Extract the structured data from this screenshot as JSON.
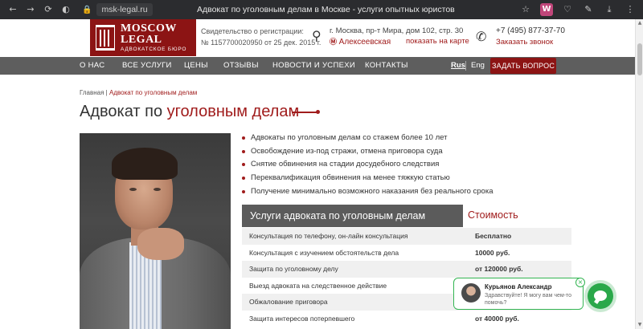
{
  "browser": {
    "url_host": "msk-legal.ru",
    "tab_title": "Адвокат по уголовным делам в Москве - услуги опытных юристов",
    "ext_w_label": "W"
  },
  "header": {
    "logo_line1": "MOSCOW",
    "logo_line2": "LEGAL",
    "logo_line3": "АДВОКАТСКОЕ БЮРО",
    "reg_line1": "Свидетельство о регистрации:",
    "reg_line2": "№ 1157700020950 от 25 дек. 2015 г.",
    "address": "г. Москва, пр-т Мира, дом 102, стр. 30",
    "metro": "Алексеевская",
    "map_link": "показать на карте",
    "phone": "+7 (495) 877-37-70",
    "callback": "Заказать звонок"
  },
  "nav": {
    "items": [
      "О НАС",
      "ВСЕ УСЛУГИ",
      "ЦЕНЫ",
      "ОТЗЫВЫ",
      "НОВОСТИ И УСПЕХИ",
      "КОНТАКТЫ"
    ],
    "lang_ru": "Rus",
    "lang_en": "Eng",
    "ask_button": "ЗАДАТЬ ВОПРОС"
  },
  "breadcrumb": {
    "home": "Главная",
    "sep": " | ",
    "current": "Адвокат по уголовным делам"
  },
  "title": {
    "plain": "Адвокат по ",
    "highlight": "уголовным делам"
  },
  "bullets": [
    "Адвокаты по уголовным делам со стажем более 10 лет",
    "Освобождение из-под стражи, отмена приговора суда",
    "Снятие обвинения на стадии досудебного следствия",
    "Переквалификация обвинения на менее тяжкую статью",
    "Получение минимально возможного наказания без реального срока"
  ],
  "services": {
    "header": "Услуги адвоката по уголовным делам",
    "cost_header": "Стоимость",
    "rows": [
      {
        "service": "Консультация по телефону, он-лайн консультация",
        "price": "Бесплатно"
      },
      {
        "service": "Консультация с изучением обстоятельств дела",
        "price": "10000 руб."
      },
      {
        "service": "Защита по уголовному делу",
        "price": "от 120000 руб."
      },
      {
        "service": "Выезд адвоката на следственное действие",
        "price": ""
      },
      {
        "service": "Обжалование приговора",
        "price": ""
      },
      {
        "service": "Защита интересов потерпевшего",
        "price": "от 40000 руб."
      }
    ]
  },
  "chat": {
    "name": "Курьянов Александр",
    "message": "Здравствуйте! Я могу вам чем-то помочь?",
    "close": "×"
  }
}
